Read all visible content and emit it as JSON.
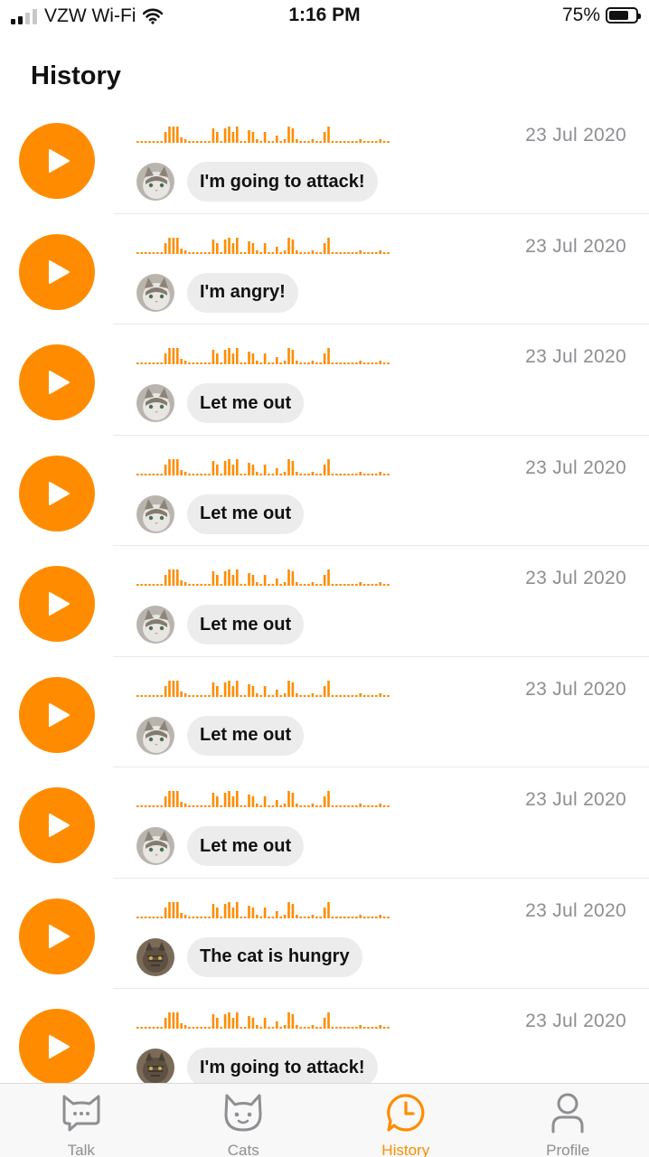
{
  "status_bar": {
    "carrier": "VZW Wi-Fi",
    "time": "1:16 PM",
    "battery": "75%"
  },
  "header": {
    "title": "History"
  },
  "colors": {
    "accent": "#ff8c00",
    "bubble": "#ececec",
    "date_text": "#8e8e93"
  },
  "history": [
    {
      "date": "23 Jul 2020",
      "message": "I'm going to attack!",
      "avatar": "cat-white"
    },
    {
      "date": "23 Jul 2020",
      "message": "I'm angry!",
      "avatar": "cat-white"
    },
    {
      "date": "23 Jul 2020",
      "message": "Let me out",
      "avatar": "cat-white"
    },
    {
      "date": "23 Jul 2020",
      "message": "Let me out",
      "avatar": "cat-white"
    },
    {
      "date": "23 Jul 2020",
      "message": "Let me out",
      "avatar": "cat-white"
    },
    {
      "date": "23 Jul 2020",
      "message": "Let me out",
      "avatar": "cat-white"
    },
    {
      "date": "23 Jul 2020",
      "message": "Let me out",
      "avatar": "cat-white"
    },
    {
      "date": "23 Jul 2020",
      "message": "The cat is hungry",
      "avatar": "cat-tabby"
    },
    {
      "date": "23 Jul 2020",
      "message": "I'm going to attack!",
      "avatar": "cat-tabby"
    }
  ],
  "tabs": [
    {
      "label": "Talk",
      "icon": "cat-chat-icon",
      "active": false
    },
    {
      "label": "Cats",
      "icon": "cat-face-icon",
      "active": false
    },
    {
      "label": "History",
      "icon": "clock-chat-icon",
      "active": true
    },
    {
      "label": "Profile",
      "icon": "person-icon",
      "active": false
    }
  ]
}
